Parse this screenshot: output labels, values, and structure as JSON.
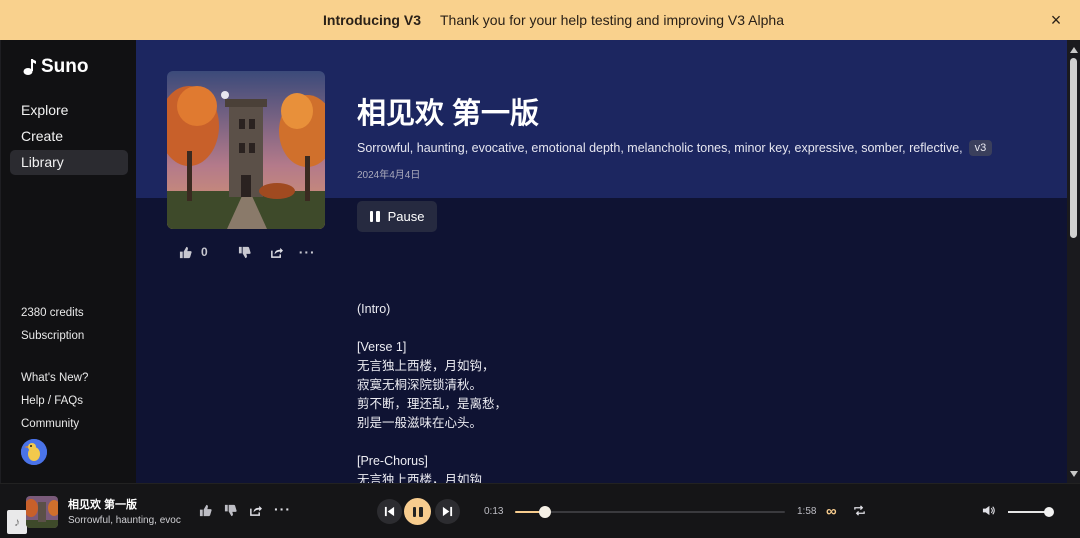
{
  "banner": {
    "title": "Introducing V3",
    "message": "Thank you for your help testing and improving V3 Alpha",
    "close_glyph": "×"
  },
  "sidebar": {
    "brand": "Suno",
    "nav": [
      {
        "label": "Explore",
        "active": false
      },
      {
        "label": "Create",
        "active": false
      },
      {
        "label": "Library",
        "active": true
      }
    ],
    "credits": "2380 credits",
    "subscription": "Subscription",
    "whats_new": "What's New?",
    "help": "Help / FAQs",
    "community": "Community"
  },
  "song": {
    "title": "相见欢 第一版",
    "tags": "Sorrowful, haunting, evocative, emotional depth, melancholic tones, minor key, expressive, somber, reflective,",
    "version_badge": "v3",
    "date": "2024年4月4日",
    "pause_label": "Pause",
    "likes": "0"
  },
  "lyrics": "(Intro)\n\n[Verse 1]\n无言独上西楼，月如钩，\n寂寞无桐深院锁清秋。\n剪不断，理还乱，是离愁，\n别是一般滋味在心头。\n\n[Pre-Chorus]\n无言独上西楼，月如钩",
  "player": {
    "title": "相见欢 第一版",
    "subtitle": "Sorrowful, haunting, evoc",
    "elapsed": "0:13",
    "duration": "1:58",
    "progress": 0.11,
    "volume": 1.0
  },
  "colors": {
    "banner": "#f9d18d",
    "accent": "#f7cc8e",
    "hero": "#1c2660",
    "main_bg": "#0f1333",
    "sidebar_bg": "#111113"
  }
}
